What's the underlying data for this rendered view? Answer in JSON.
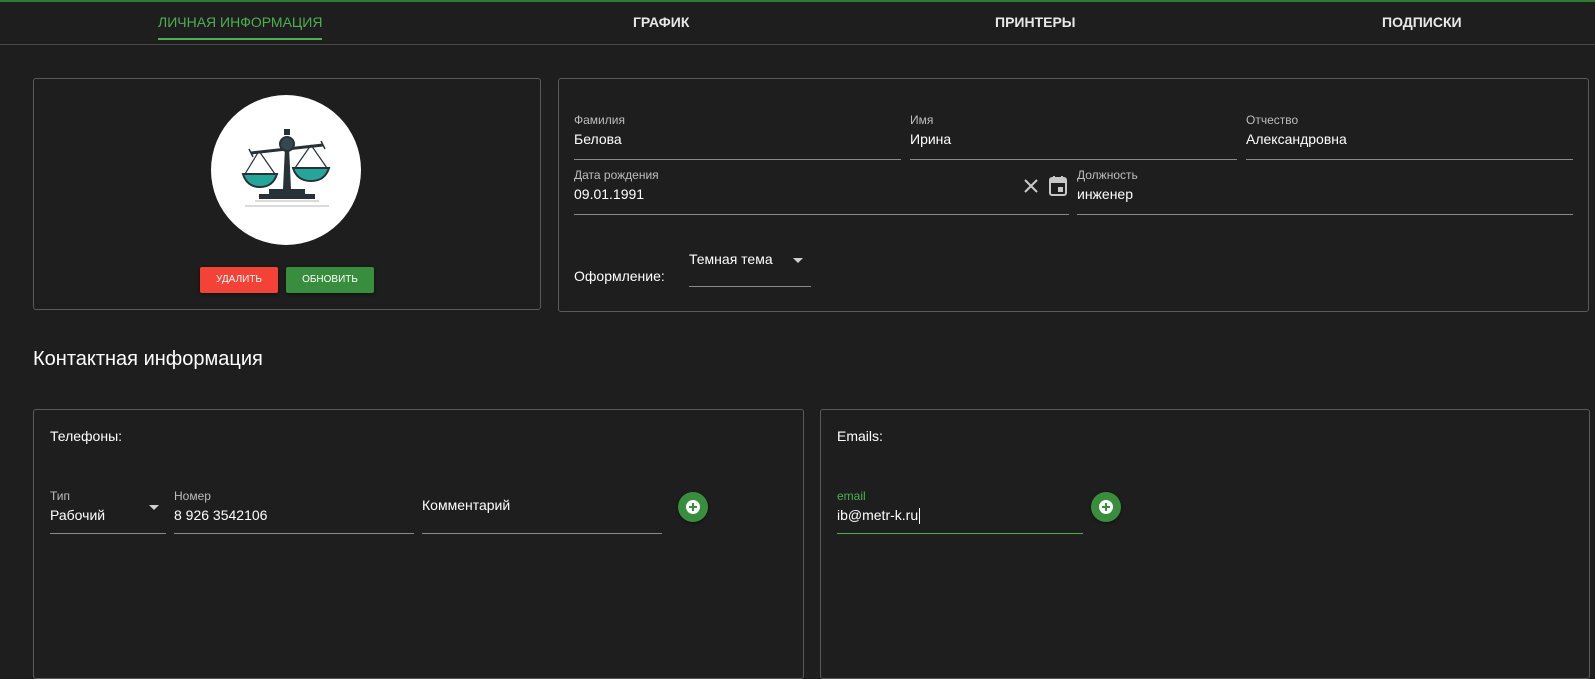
{
  "tabs": [
    {
      "label": "Личная информация",
      "active": true
    },
    {
      "label": "График",
      "active": false
    },
    {
      "label": "Принтеры",
      "active": false
    },
    {
      "label": "Подписки",
      "active": false
    }
  ],
  "profile": {
    "avatar_icon": "scales-icon",
    "delete_label": "Удалить",
    "update_label": "Обновить"
  },
  "personal": {
    "last_name": {
      "label": "Фамилия",
      "value": "Белова"
    },
    "first_name": {
      "label": "Имя",
      "value": "Ирина"
    },
    "patronymic": {
      "label": "Отчество",
      "value": "Александровна"
    },
    "birth_date": {
      "label": "Дата рождения",
      "value": "09.01.1991"
    },
    "position": {
      "label": "Должность",
      "value": "инженер"
    },
    "theme": {
      "label": "Оформление:",
      "value": "Темная тема"
    }
  },
  "contacts": {
    "title": "Контактная информация",
    "phones": {
      "title": "Телефоны:",
      "type": {
        "label": "Тип",
        "value": "Рабочий"
      },
      "number": {
        "label": "Номер",
        "value": "8 926 3542106"
      },
      "comment": {
        "placeholder": "Комментарий"
      }
    },
    "emails": {
      "title": "Emails:",
      "email": {
        "label": "email",
        "value": "ib@metr-k.ru"
      }
    }
  },
  "colors": {
    "accent": "#4caf50",
    "danger": "#f44336",
    "success": "#388e3c",
    "background": "#1e1e1e"
  }
}
